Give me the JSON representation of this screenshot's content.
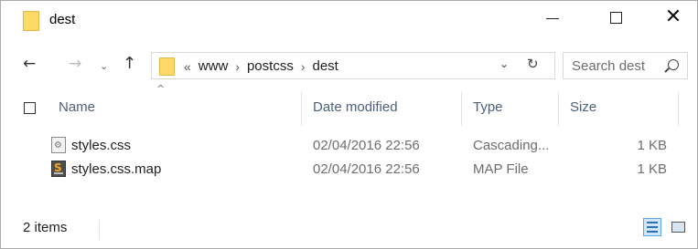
{
  "window": {
    "title": "dest",
    "controls": {
      "minimize_icon": "minimize-icon",
      "maximize_icon": "maximize-icon",
      "close_icon": "close-icon",
      "close_glyph": "✕"
    }
  },
  "nav": {
    "back_glyph": "←",
    "forward_glyph": "→",
    "recent_glyph": "⌄",
    "up_glyph": "↑",
    "address": {
      "overflow": "«",
      "crumbs": [
        "www",
        "postcss",
        "dest"
      ],
      "separator": "›",
      "dropdown_glyph": "⌄",
      "refresh_glyph": "↻"
    },
    "search": {
      "placeholder": "Search dest"
    }
  },
  "columns": {
    "name": "Name",
    "date": "Date modified",
    "type": "Type",
    "size": "Size",
    "sort_glyph": "^"
  },
  "files": [
    {
      "name": "styles.css",
      "date": "02/04/2016 22:56",
      "type": "Cascading...",
      "size": "1 KB",
      "icon": "css-file-icon"
    },
    {
      "name": "styles.css.map",
      "date": "02/04/2016 22:56",
      "type": "MAP File",
      "size": "1 KB",
      "icon": "map-file-icon"
    }
  ],
  "status": {
    "item_count": "2 items"
  },
  "colors": {
    "folder": "#ffd966",
    "header_text": "#4c607a",
    "accent": "#cde6fa"
  }
}
